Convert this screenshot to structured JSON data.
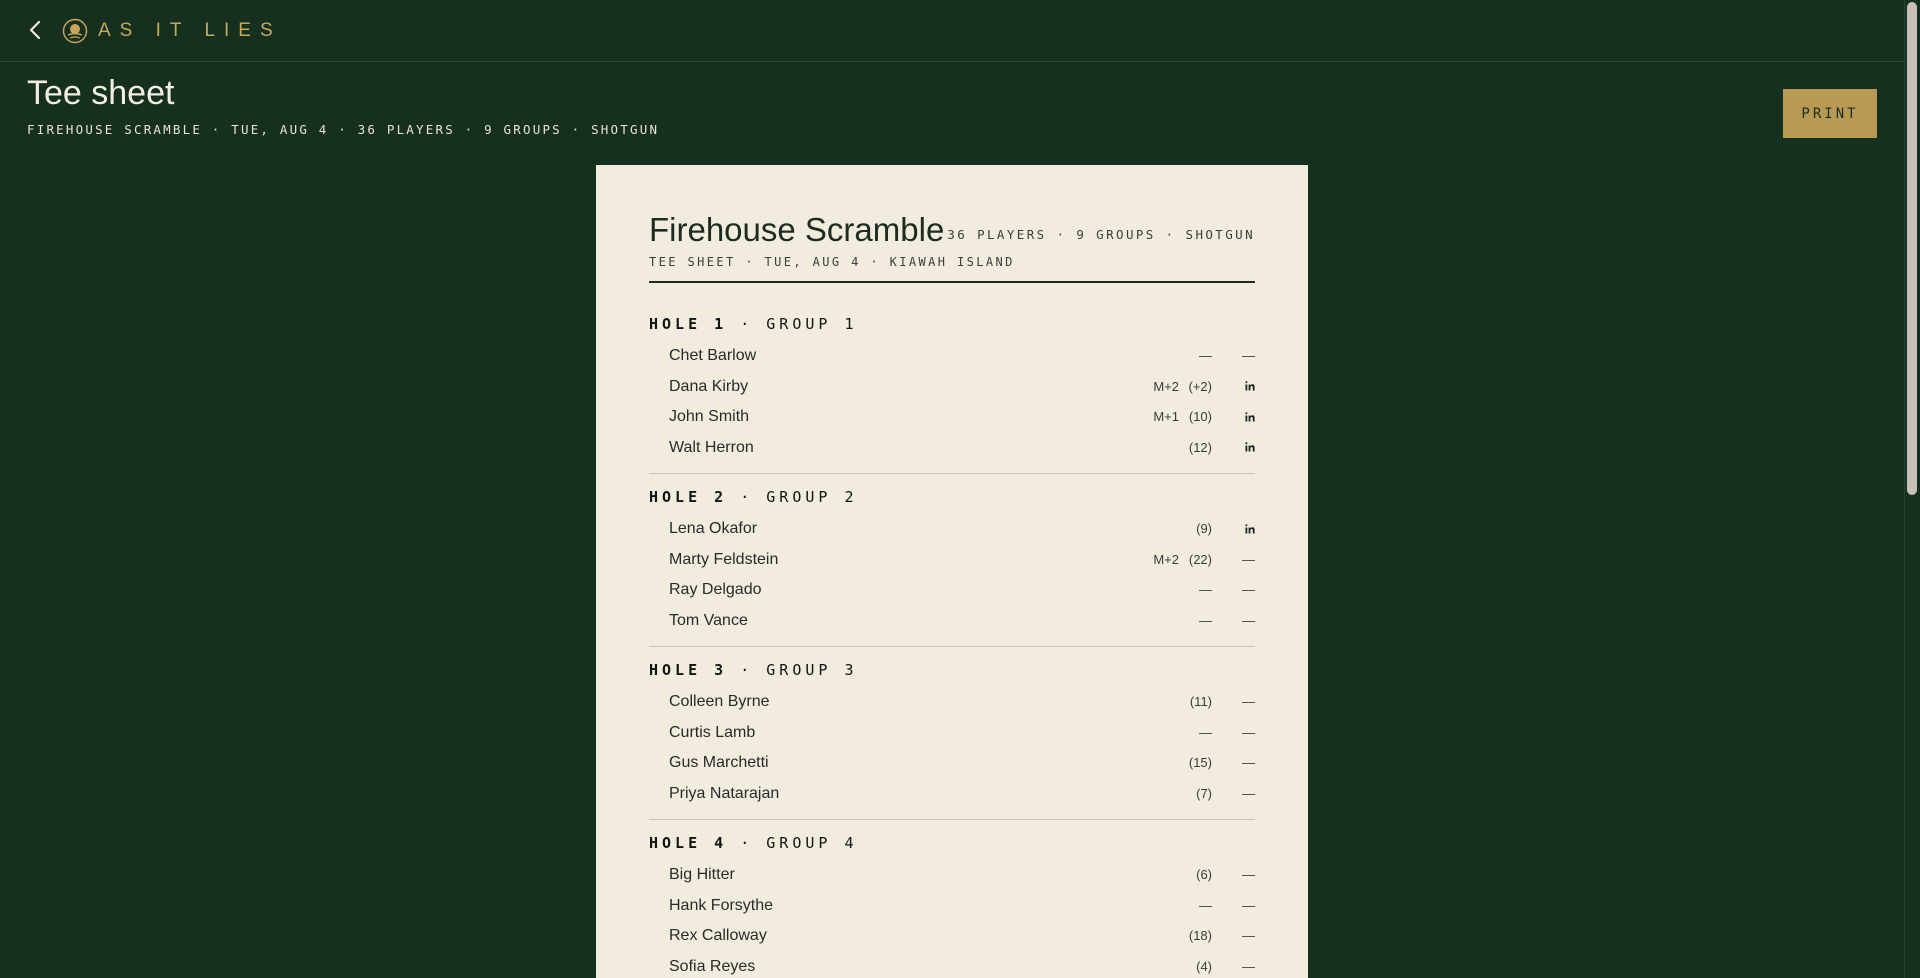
{
  "app": {
    "brand": "AS IT LIES"
  },
  "header": {
    "title": "Tee sheet",
    "subtitle": "FIREHOUSE SCRAMBLE · TUE, AUG 4 · 36 PLAYERS · 9 GROUPS · SHOTGUN",
    "print_label": "PRINT"
  },
  "sheet": {
    "title": "Firehouse Scramble",
    "meta": "TEE SHEET · TUE, AUG 4 · KIAWAH ISLAND",
    "summary": "36 PLAYERS · 9 GROUPS · SHOTGUN",
    "groups": [
      {
        "hole": "HOLE 1",
        "group": "· GROUP 1",
        "players": [
          {
            "name": "Chet Barlow",
            "mod": "",
            "hcp": "—",
            "stat": "—"
          },
          {
            "name": "Dana Kirby",
            "mod": "M+2",
            "hcp": "(+2)",
            "stat": "in"
          },
          {
            "name": "John Smith",
            "mod": "M+1",
            "hcp": "(10)",
            "stat": "in"
          },
          {
            "name": "Walt Herron",
            "mod": "",
            "hcp": "(12)",
            "stat": "in"
          }
        ]
      },
      {
        "hole": "HOLE 2",
        "group": "· GROUP 2",
        "players": [
          {
            "name": "Lena Okafor",
            "mod": "",
            "hcp": "(9)",
            "stat": "in"
          },
          {
            "name": "Marty Feldstein",
            "mod": "M+2",
            "hcp": "(22)",
            "stat": "—"
          },
          {
            "name": "Ray Delgado",
            "mod": "",
            "hcp": "—",
            "stat": "—"
          },
          {
            "name": "Tom Vance",
            "mod": "",
            "hcp": "—",
            "stat": "—"
          }
        ]
      },
      {
        "hole": "HOLE 3",
        "group": "· GROUP 3",
        "players": [
          {
            "name": "Colleen Byrne",
            "mod": "",
            "hcp": "(11)",
            "stat": "—"
          },
          {
            "name": "Curtis Lamb",
            "mod": "",
            "hcp": "—",
            "stat": "—"
          },
          {
            "name": "Gus Marchetti",
            "mod": "",
            "hcp": "(15)",
            "stat": "—"
          },
          {
            "name": "Priya Natarajan",
            "mod": "",
            "hcp": "(7)",
            "stat": "—"
          }
        ]
      },
      {
        "hole": "HOLE 4",
        "group": "· GROUP 4",
        "players": [
          {
            "name": "Big Hitter",
            "mod": "",
            "hcp": "(6)",
            "stat": "—"
          },
          {
            "name": "Hank Forsythe",
            "mod": "",
            "hcp": "—",
            "stat": "—"
          },
          {
            "name": "Rex Calloway",
            "mod": "",
            "hcp": "(18)",
            "stat": "—"
          },
          {
            "name": "Sofia Reyes",
            "mod": "",
            "hcp": "(4)",
            "stat": "—"
          }
        ]
      }
    ]
  },
  "icons": {
    "back": "chevron-left-icon",
    "logo": "logo-icon",
    "status": "linkedin-icon"
  },
  "colors": {
    "background": "#16301f",
    "accent": "#c8a75a",
    "button": "#b99a52",
    "paper": "#f2ecdf"
  }
}
